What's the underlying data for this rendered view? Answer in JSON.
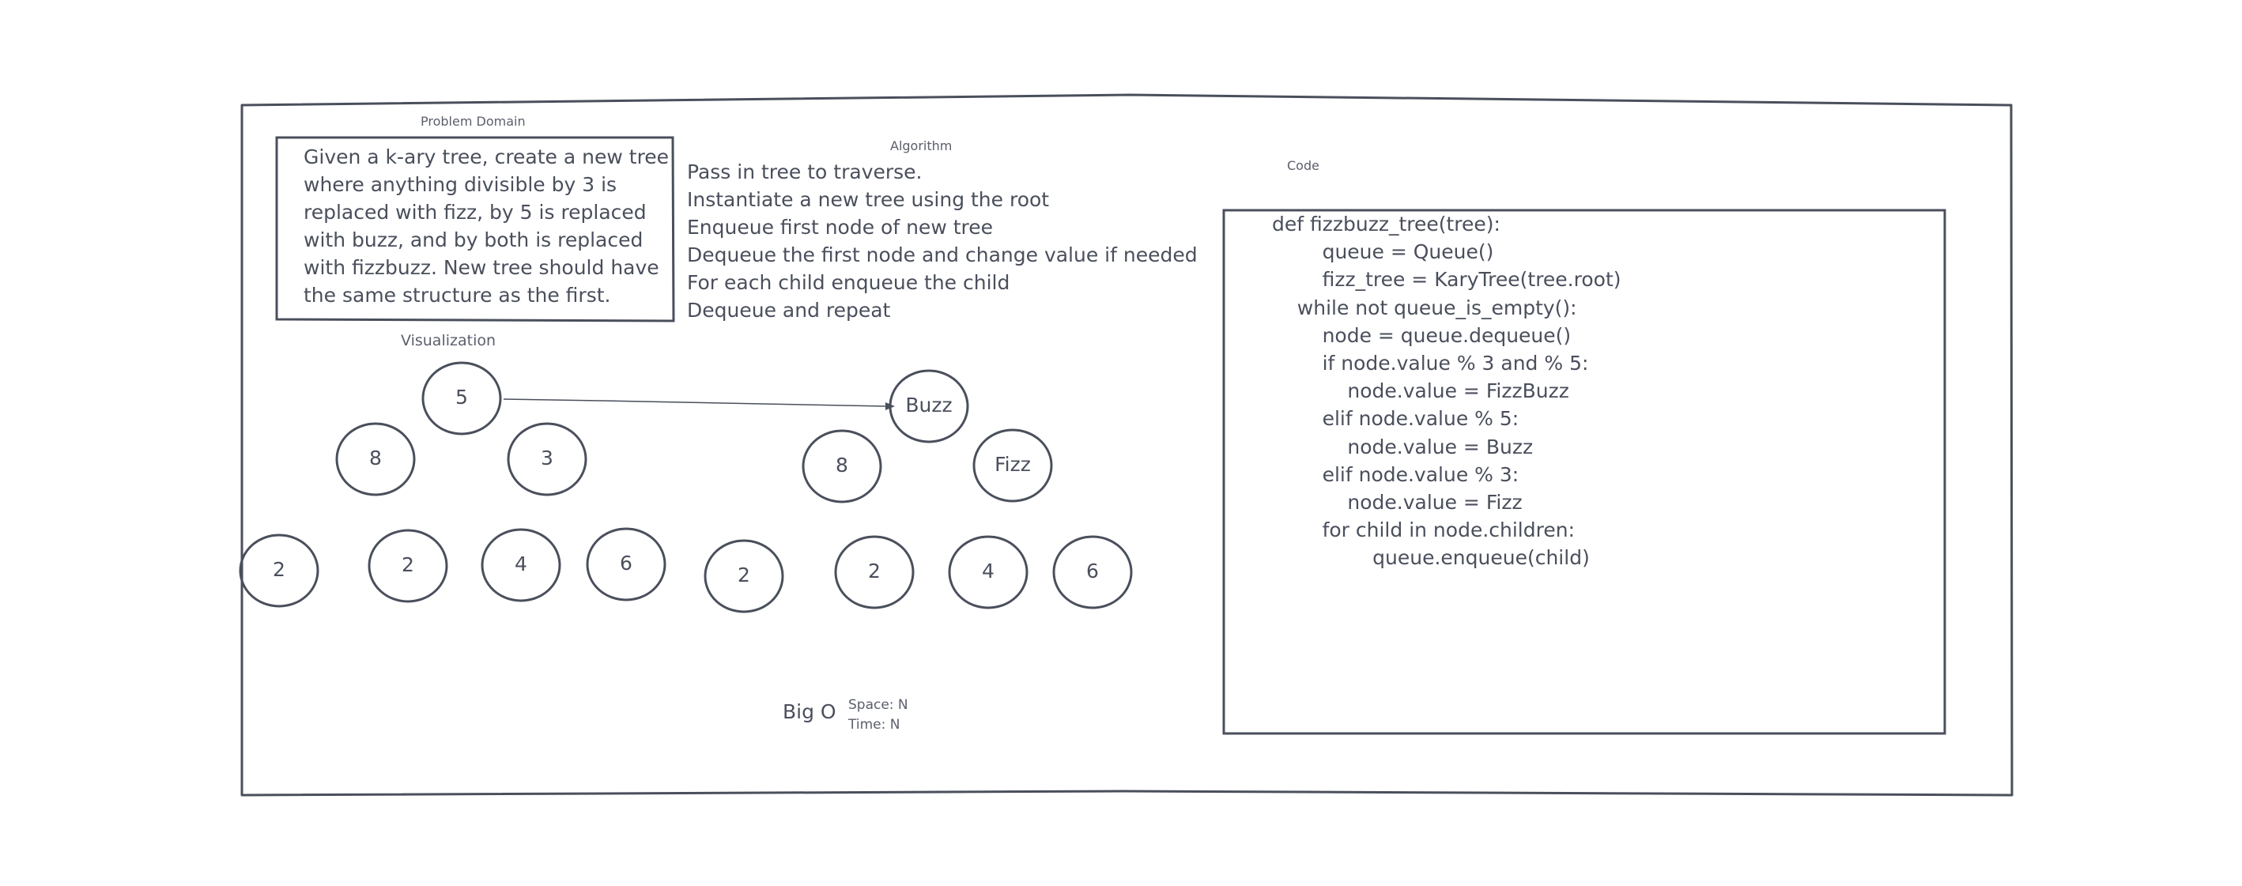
{
  "problem_domain": {
    "title": "Problem Domain",
    "lines": [
      "Given a k-ary tree, create a new tree",
      "where anything divisible by 3 is",
      "replaced with fizz, by 5 is replaced",
      "with buzz, and by both is replaced",
      "with fizzbuzz. New tree should have",
      "the same structure as the first."
    ]
  },
  "algorithm": {
    "title": "Algorithm",
    "lines": [
      "Pass in tree to traverse.",
      "Instantiate a new tree using the root",
      "Enqueue first node of new tree",
      "Dequeue the first node and change value if needed",
      "For each child enqueue the child",
      "Dequeue and repeat"
    ]
  },
  "code": {
    "title": "Code",
    "lines": [
      "def fizzbuzz_tree(tree):",
      "        queue = Queue()",
      "        fizz_tree = KaryTree(tree.root)",
      "",
      "    while not queue_is_empty():",
      "        node = queue.dequeue()",
      "        if node.value % 3 and % 5:",
      "            node.value = FizzBuzz",
      "        elif node.value % 5:",
      "            node.value = Buzz",
      "        elif node.value % 3:",
      "            node.value = Fizz",
      "        for child in node.children:",
      "                queue.enqueue(child)"
    ]
  },
  "visualization": {
    "title": "Visualization",
    "original_tree": [
      "5",
      "8",
      "3",
      "2",
      "2",
      "4",
      "6"
    ],
    "new_tree": [
      "Buzz",
      "8",
      "Fizz",
      "2",
      "2",
      "4",
      "6"
    ]
  },
  "big_o": {
    "title": "Big O",
    "space": "Space: N",
    "time": "Time: N"
  },
  "colors": {
    "stroke": "#4a4f5c",
    "text": "#4a4f5c",
    "background": "#ffffff"
  }
}
